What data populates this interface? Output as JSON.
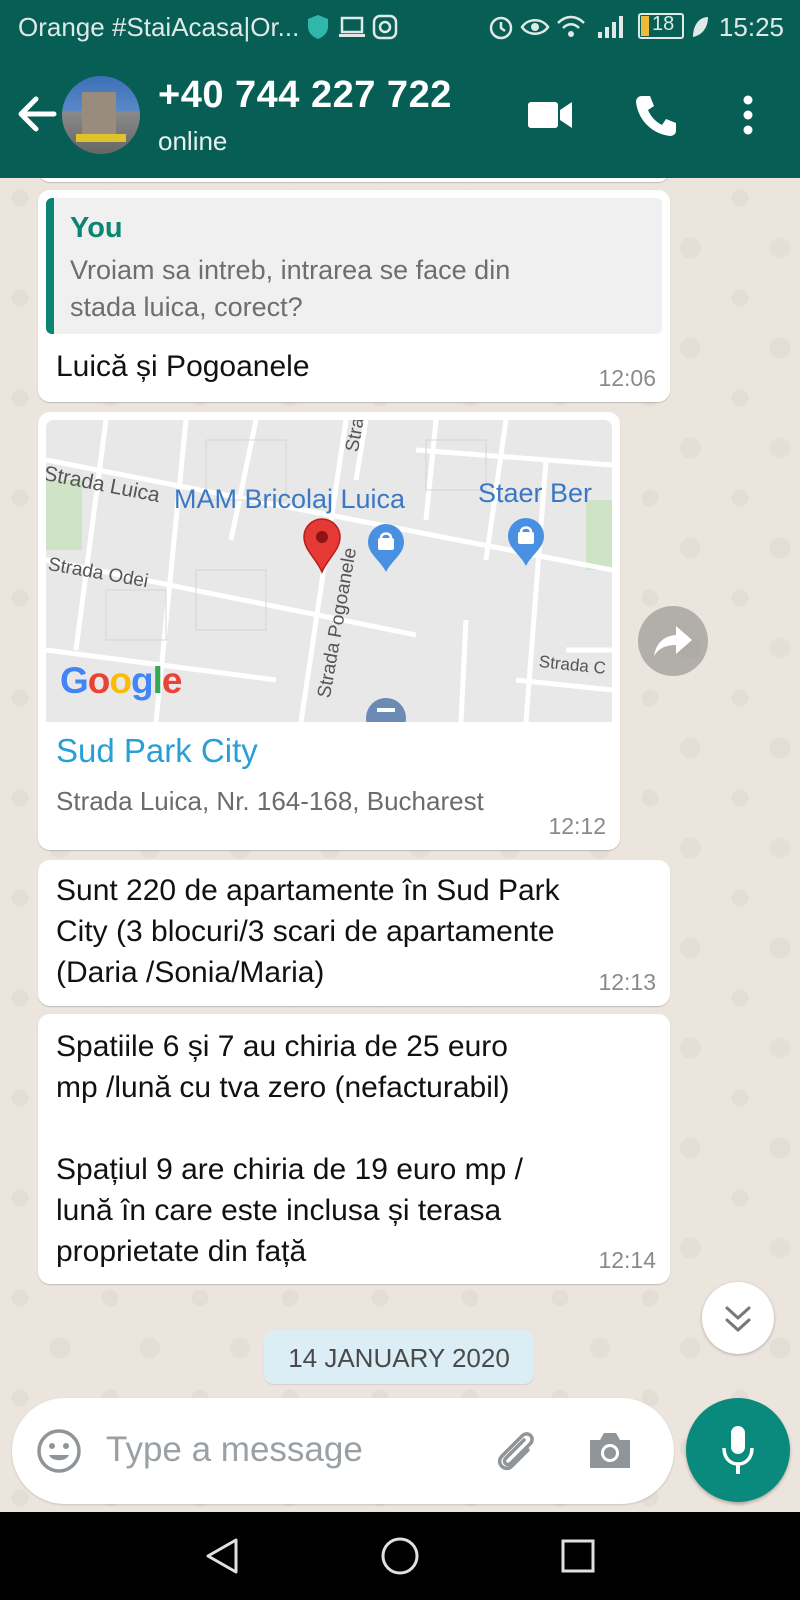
{
  "status_bar": {
    "carrier": "Orange #StaiAcasa|Or...",
    "battery": "18",
    "time": "15:25"
  },
  "header": {
    "contact": "+40 744 227 722",
    "status": "online"
  },
  "messages": {
    "m1": {
      "quote_author": "You",
      "quote_text": "Vroiam sa intreb, intrarea se face din\nstada luica, corect?",
      "text": "Luică și Pogoanele",
      "time": "12:06"
    },
    "m2": {
      "map_labels": {
        "strada_luica": "Strada Luica",
        "strada": "Strada",
        "mam": "MAM Bricolaj Luica",
        "staer": "Staer Ber",
        "odei": "Strada Odei",
        "pogoanele": "Strada Pogoanele",
        "strada_c": "Strada C",
        "google": "Google"
      },
      "place_name": "Sud Park City",
      "address": "Strada Luica,  Nr. 164-168, Bucharest",
      "time": "12:12"
    },
    "m3": {
      "text": "Sunt 220 de apartamente în Sud Park\nCity (3 blocuri/3 scari de apartamente\n(Daria /Sonia/Maria)",
      "time": "12:13"
    },
    "m4": {
      "text": "Spatiile 6 și 7 au chiria de 25 euro\nmp /lună cu tva zero (nefacturabil)\n\nSpațiul 9 are chiria de 19 euro mp /\nlună în care este inclusa și terasa\nproprietate din față",
      "time": "12:14"
    }
  },
  "date_chip": "14 JANUARY 2020",
  "input": {
    "placeholder": "Type a message"
  },
  "colors": {
    "header": "#075e54",
    "accent": "#0a8a7c",
    "link": "#2a9fd6",
    "chat_bg": "#ece5dd"
  }
}
